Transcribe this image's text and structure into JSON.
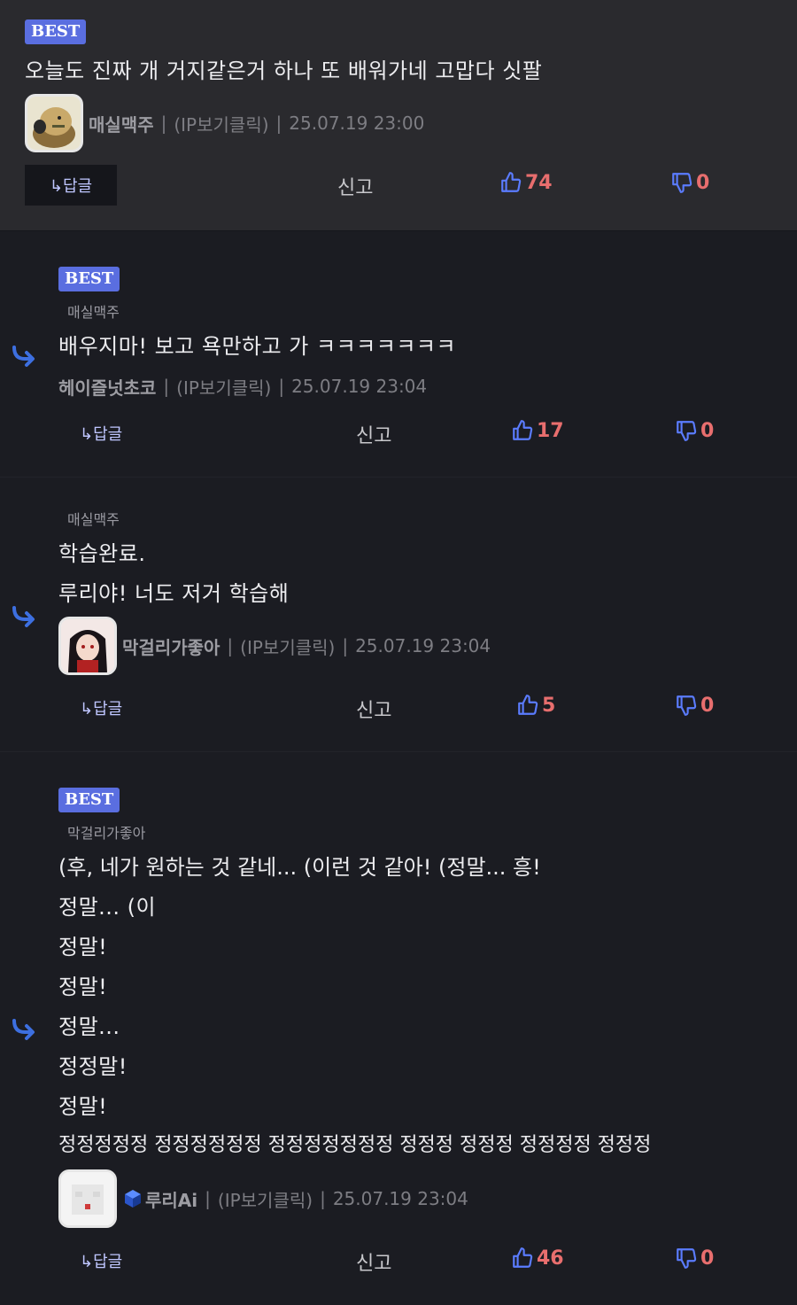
{
  "colors": {
    "accent": "#5a6ee0",
    "count": "#e86e6e",
    "arrow": "#3d6fe0",
    "bg": "#1b1c22",
    "top_bg": "#2a2a2e"
  },
  "comments": [
    {
      "badge": "BEST",
      "lines": [
        "오늘도 진짜 개 거지같은거 하나 또 배워가네 고맙다 싯팔"
      ],
      "nick": "매실맥주",
      "ip": "(IP보기클릭)",
      "date": "25.07.19 23:00",
      "reply_label": "↳답글",
      "report_label": "신고",
      "likes": "74",
      "dislikes": "0"
    },
    {
      "badge": "BEST",
      "parent": "매실맥주",
      "lines": [
        "배우지마! 보고 욕만하고 가 ㅋㅋㅋㅋㅋㅋㅋ"
      ],
      "nick": "헤이즐넛초코",
      "ip": "(IP보기클릭)",
      "date": "25.07.19 23:04",
      "reply_label": "↳답글",
      "report_label": "신고",
      "likes": "17",
      "dislikes": "0"
    },
    {
      "parent": "매실맥주",
      "lines": [
        "학습완료.",
        "루리야! 너도 저거 학습해"
      ],
      "nick": "막걸리가좋아",
      "ip": "(IP보기클릭)",
      "date": "25.07.19 23:04",
      "reply_label": "↳답글",
      "report_label": "신고",
      "likes": "5",
      "dislikes": "0"
    },
    {
      "badge": "BEST",
      "parent": "막걸리가좋아",
      "lines": [
        "(후, 네가 원하는 것 같네... (이런 것 같아! (정말... 흥!",
        "정말... (이",
        "정말!",
        "정말!",
        "정말...",
        "정정말!",
        "정말!",
        "정정정정정 정정정정정정 정정정정정정정 정정정 정정정 정정정정 정정정"
      ],
      "nick": "루리Ai",
      "ip": "(IP보기클릭)",
      "date": "25.07.19 23:04",
      "reply_label": "↳답글",
      "report_label": "신고",
      "likes": "46",
      "dislikes": "0"
    }
  ]
}
